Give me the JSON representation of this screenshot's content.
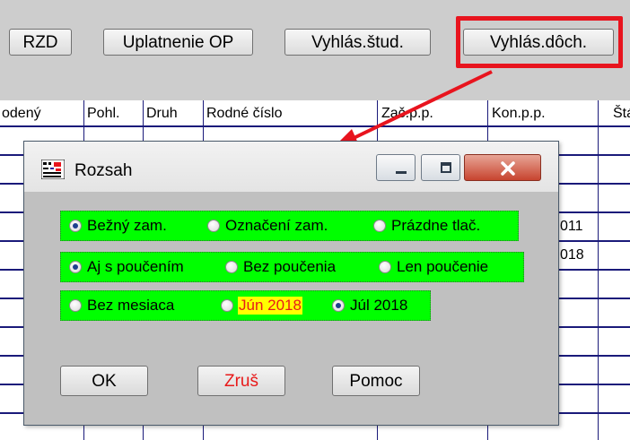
{
  "toolbar": {
    "buttons": [
      "RZD",
      "Uplatnenie OP",
      "Vyhlás.štud.",
      "Vyhlás.dôch."
    ]
  },
  "grid": {
    "columns": [
      "odený",
      "Pohl.",
      "Druh",
      "Rodné číslo",
      "Zač.p.p.",
      "Kon.p.p.",
      "Štá"
    ],
    "visible_cells": [
      "011",
      "018"
    ]
  },
  "dialog": {
    "title": "Rozsah",
    "group1": [
      "Bežný zam.",
      "Označení zam.",
      "Prázdne tlač."
    ],
    "group2": [
      "Aj s poučením",
      "Bez poučenia",
      "Len poučenie"
    ],
    "group3": [
      "Bez mesiaca",
      "Jún 2018",
      "Júl 2018"
    ],
    "buttons": {
      "ok": "OK",
      "cancel": "Zruš",
      "help": "Pomoc"
    }
  },
  "colors": {
    "highlight": "#e8141e",
    "group_bg": "#00ff00",
    "month_highlight_bg": "#ffff00",
    "month_highlight_fg": "#e81a1a",
    "cancel_fg": "#e81a1a",
    "grid_lines": "#1a1a7a"
  },
  "icons": [
    "app-icon",
    "minimize-icon",
    "maximize-icon",
    "close-icon"
  ]
}
